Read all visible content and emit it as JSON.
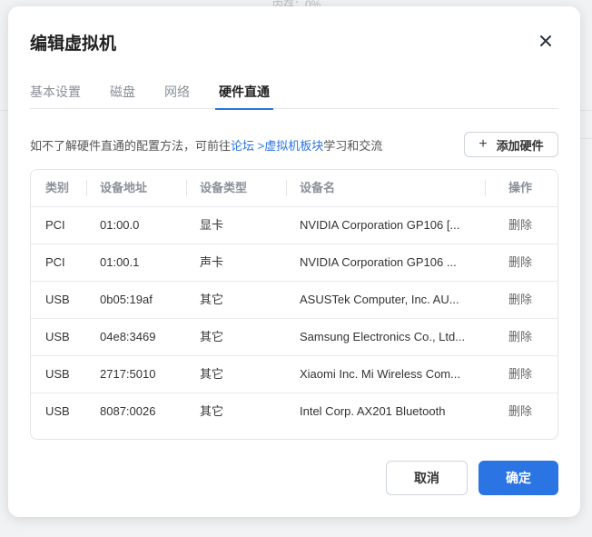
{
  "background": {
    "faint_text": "内存：0%"
  },
  "dialog": {
    "title": "编辑虚拟机",
    "tabs": [
      {
        "label": "基本设置",
        "active": false
      },
      {
        "label": "磁盘",
        "active": false
      },
      {
        "label": "网络",
        "active": false
      },
      {
        "label": "硬件直通",
        "active": true
      }
    ],
    "hint": {
      "prefix": "如不了解硬件直通的配置方法，可前往",
      "link1": "论坛",
      "link2": " >虚拟机板块",
      "suffix": "学习和交流"
    },
    "add_button": "添加硬件",
    "table": {
      "headers": [
        "类别",
        "设备地址",
        "设备类型",
        "设备名",
        "操作"
      ],
      "rows": [
        {
          "category": "PCI",
          "address": "01:00.0",
          "type": "显卡",
          "name": "NVIDIA Corporation GP106 [...",
          "action": "删除"
        },
        {
          "category": "PCI",
          "address": "01:00.1",
          "type": "声卡",
          "name": "NVIDIA Corporation GP106 ...",
          "action": "删除"
        },
        {
          "category": "USB",
          "address": "0b05:19af",
          "type": "其它",
          "name": "ASUSTek Computer, Inc. AU...",
          "action": "删除"
        },
        {
          "category": "USB",
          "address": "04e8:3469",
          "type": "其它",
          "name": "Samsung Electronics Co., Ltd...",
          "action": "删除"
        },
        {
          "category": "USB",
          "address": "2717:5010",
          "type": "其它",
          "name": "Xiaomi Inc. Mi Wireless Com...",
          "action": "删除"
        },
        {
          "category": "USB",
          "address": "8087:0026",
          "type": "其它",
          "name": "Intel Corp. AX201 Bluetooth",
          "action": "删除"
        }
      ]
    },
    "cancel_button": "取消",
    "ok_button": "确定"
  },
  "colors": {
    "accent": "#2a74e3",
    "muted": "#8a9099"
  },
  "icons": {
    "close": "close-icon",
    "add": "plus-icon"
  }
}
